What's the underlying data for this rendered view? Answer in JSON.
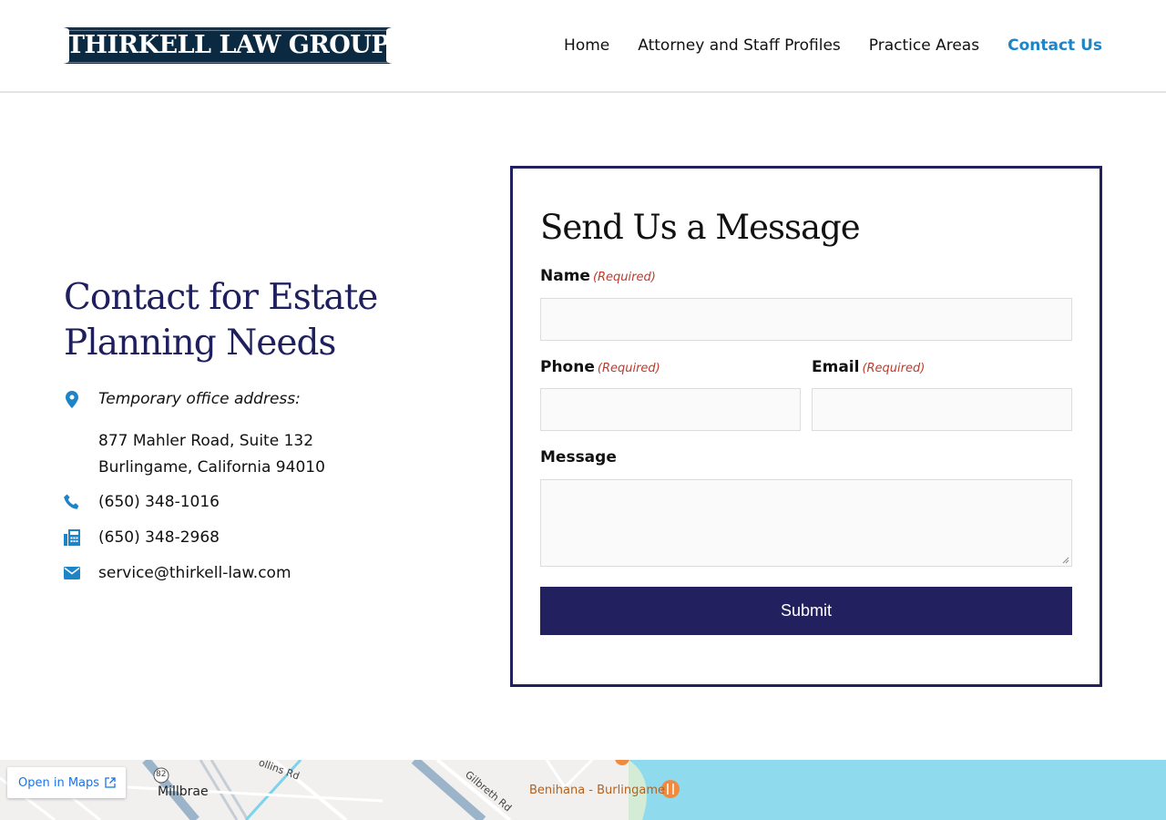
{
  "header": {
    "logo_text": "THIRKELL LAW GROUP",
    "nav": [
      {
        "label": "Home"
      },
      {
        "label": "Attorney and Staff Profiles"
      },
      {
        "label": "Practice Areas"
      },
      {
        "label": "Contact Us",
        "active": true
      }
    ]
  },
  "contact": {
    "title": "Contact for Estate Planning Needs",
    "address_label": "Temporary office address:",
    "address_line1": "877 Mahler Road, Suite 132",
    "address_line2": "Burlingame, California 94010",
    "phone": "(650) 348-1016",
    "fax": "(650) 348-2968",
    "email": "service@thirkell-law.com"
  },
  "form": {
    "title": "Send Us a Message",
    "required_text": "(Required)",
    "name_label": "Name",
    "phone_label": "Phone",
    "email_label": "Email",
    "message_label": "Message",
    "name_value": "",
    "phone_value": "",
    "email_value": "",
    "message_value": "",
    "submit_label": "Submit"
  },
  "map": {
    "open_in_maps": "Open in Maps",
    "place_millbrae": "Millbrae",
    "place_benihana": "Benihana - Burlingame",
    "road_gilbreth": "Gilbreth Rd",
    "road_rollins": "ollins Rd",
    "route_marker": "82",
    "water_color": "#90daee",
    "accent_color": "#1e84c8",
    "brand_navy": "#22205e"
  }
}
